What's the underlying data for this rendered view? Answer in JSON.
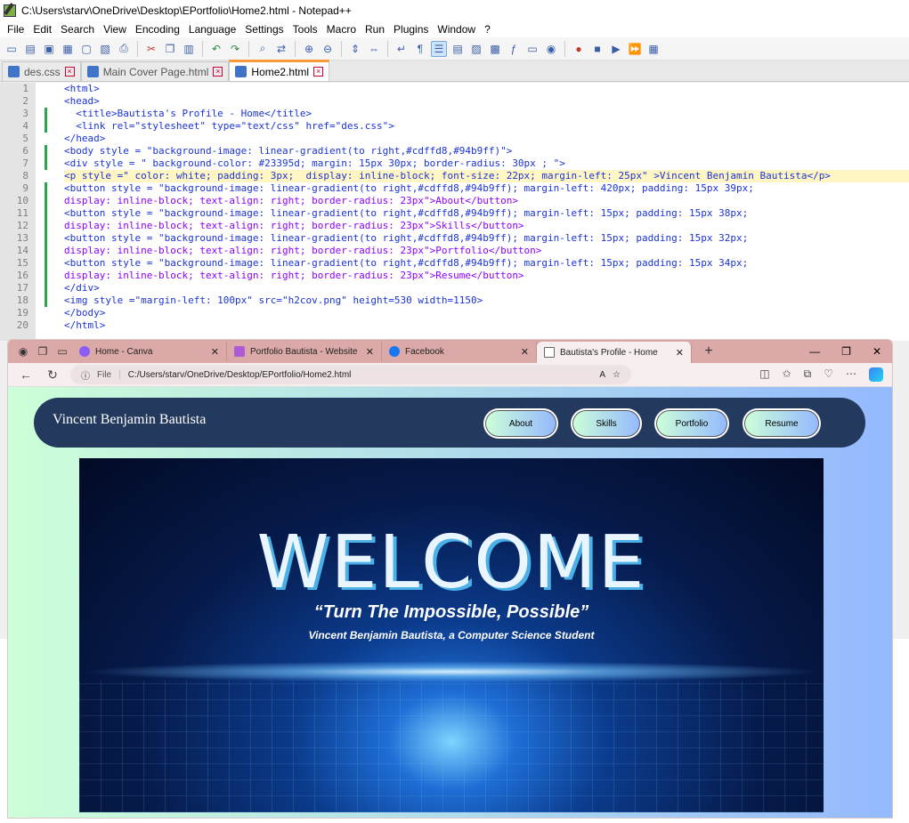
{
  "notepad": {
    "title": "C:\\Users\\starv\\OneDrive\\Desktop\\EPortfolio\\Home2.html - Notepad++",
    "menu": [
      "File",
      "Edit",
      "Search",
      "View",
      "Encoding",
      "Language",
      "Settings",
      "Tools",
      "Macro",
      "Run",
      "Plugins",
      "Window",
      "?"
    ],
    "tabs": [
      "des.css",
      "Main Cover Page.html",
      "Home2.html"
    ],
    "line_numbers": [
      "1",
      "2",
      "3",
      "4",
      "5",
      "6",
      "7",
      "8",
      "9",
      "10",
      "11",
      "12",
      "13",
      "14",
      "15",
      "16",
      "17",
      "18",
      "19",
      "20"
    ],
    "lines": [
      "<html>",
      "<head>",
      "  <title>Bautista's Profile - Home</title>",
      "  <link rel=\"stylesheet\" type=\"text/css\" href=\"des.css\">",
      "</head>",
      "<body style = \"background-image: linear-gradient(to right,#cdffd8,#94b9ff)\">",
      "<div style = \" background-color: #23395d; margin: 15px 30px; border-radius: 30px ; \">",
      "<p style =\" color: white; padding: 3px;  display: inline-block; font-size: 22px; margin-left: 25px\" >Vincent Benjamin Bautista</p>",
      "<button style = \"background-image: linear-gradient(to right,#cdffd8,#94b9ff); margin-left: 420px; padding: 15px 39px;",
      "display: inline-block; text-align: right; border-radius: 23px\">About</button>",
      "<button style = \"background-image: linear-gradient(to right,#cdffd8,#94b9ff); margin-left: 15px; padding: 15px 38px;",
      "display: inline-block; text-align: right; border-radius: 23px\">Skills</button>",
      "<button style = \"background-image: linear-gradient(to right,#cdffd8,#94b9ff); margin-left: 15px; padding: 15px 32px;",
      "display: inline-block; text-align: right; border-radius: 23px\">Portfolio</button>",
      "<button style = \"background-image: linear-gradient(to right,#cdffd8,#94b9ff); margin-left: 15px; padding: 15px 34px;",
      "display: inline-block; text-align: right; border-radius: 23px\">Resume</button>",
      "</div>",
      "<img style =\"margin-left: 100px\" src=\"h2cov.png\" height=530 width=1150>",
      "</body>",
      "</html>"
    ]
  },
  "browser": {
    "tabs": [
      "Home - Canva",
      "Portfolio Bautista - Website",
      "Facebook",
      "Bautista's Profile - Home"
    ],
    "new_tab": "+",
    "address_label": "File",
    "address": "C:/Users/starv/OneDrive/Desktop/EPortfolio/Home2.html"
  },
  "page": {
    "name": "Vincent Benjamin Bautista",
    "nav": [
      "About",
      "Skills",
      "Portfolio",
      "Resume"
    ],
    "cover": {
      "headline": "WELCOME",
      "quote": "“Turn The Impossible, Possible”",
      "subtitle": "Vincent Benjamin Bautista, a Computer Science Student"
    }
  },
  "colors": {
    "header_bg": "#23395d",
    "gradient_start": "#cdffd8",
    "gradient_end": "#94b9ff",
    "np_tab_accent": "#fa9b3a"
  }
}
